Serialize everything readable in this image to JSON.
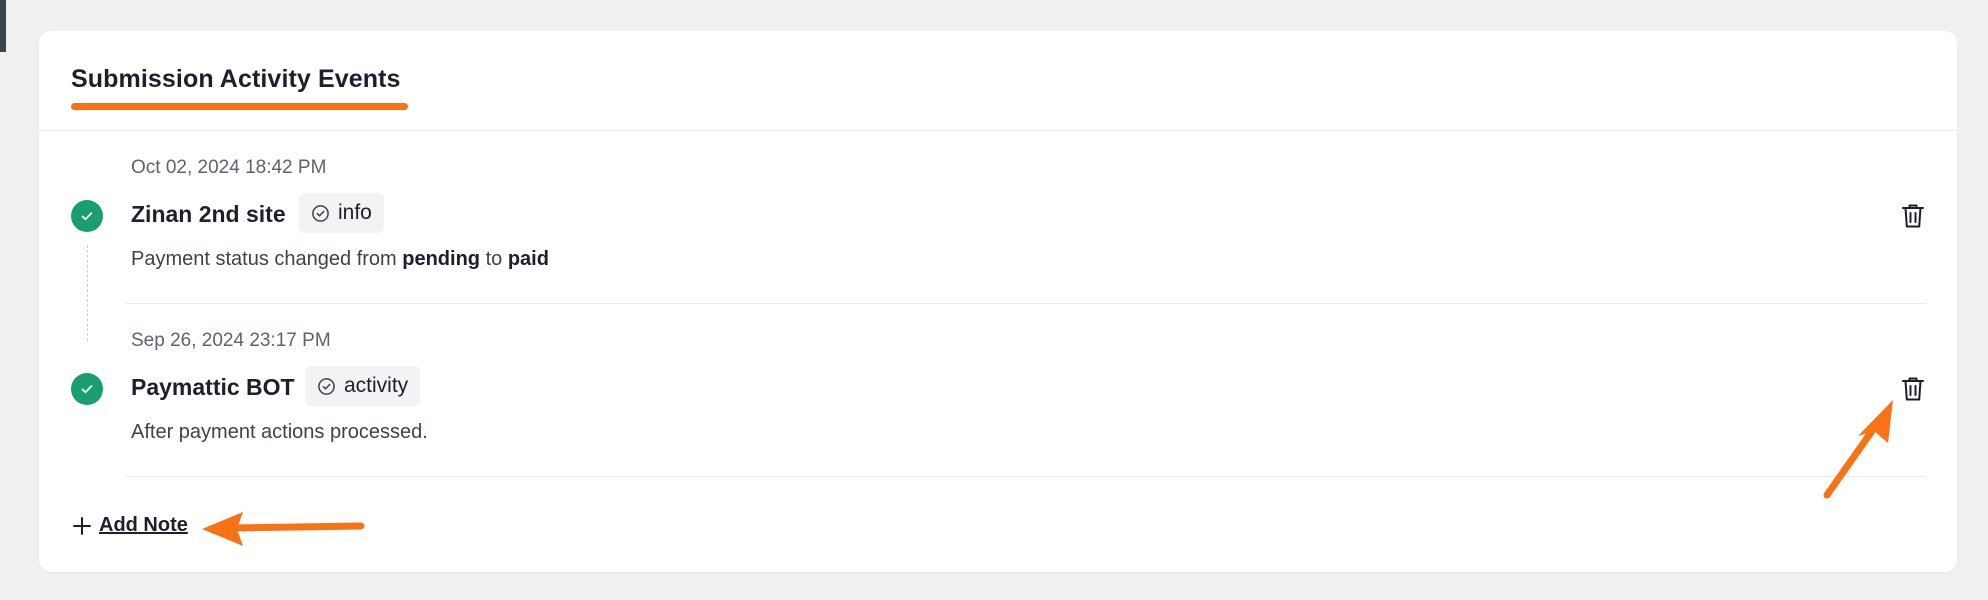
{
  "panel": {
    "title": "Submission Activity Events"
  },
  "events": [
    {
      "timestamp": "Oct 02, 2024 18:42 PM",
      "title": "Zinan 2nd site",
      "badge": "info",
      "desc_prefix": "Payment status changed from ",
      "desc_from": "pending",
      "desc_mid": " to ",
      "desc_to": "paid"
    },
    {
      "timestamp": "Sep 26, 2024 23:17 PM",
      "title": "Paymattic BOT",
      "badge": "activity",
      "desc": "After payment actions processed."
    }
  ],
  "actions": {
    "add_note_label": "Add Note"
  },
  "colors": {
    "accent": "#f97316",
    "success": "#199f6f",
    "text": "#1e1e2d"
  },
  "icons": {
    "status": "check-circle-icon",
    "badge": "check-circle-outline-icon",
    "delete": "trash-icon",
    "add": "plus-icon"
  }
}
